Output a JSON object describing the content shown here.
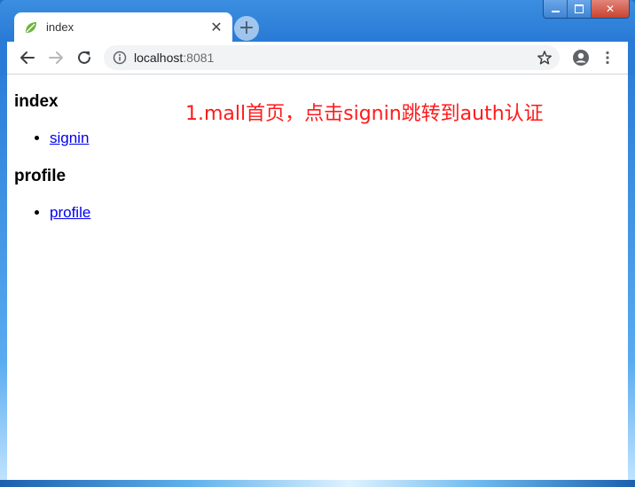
{
  "window": {
    "controls": {
      "minimize_icon": "minimize-icon",
      "maximize_icon": "maximize-icon",
      "close_label": "✕"
    }
  },
  "tab": {
    "title": "index",
    "favicon": "spring-leaf-icon",
    "close_label": "✕"
  },
  "new_tab_label": "+",
  "toolbar": {
    "url_host": "localhost",
    "url_port": ":8081"
  },
  "page": {
    "sections": [
      {
        "heading": "index",
        "link": "signin"
      },
      {
        "heading": "profile",
        "link": "profile"
      }
    ]
  },
  "annotation": "1.mall首页，点击signin跳转到auth认证",
  "colors": {
    "annotation": "#ff1a1a",
    "link": "#0000ee",
    "frame": "#2c7ed8"
  }
}
